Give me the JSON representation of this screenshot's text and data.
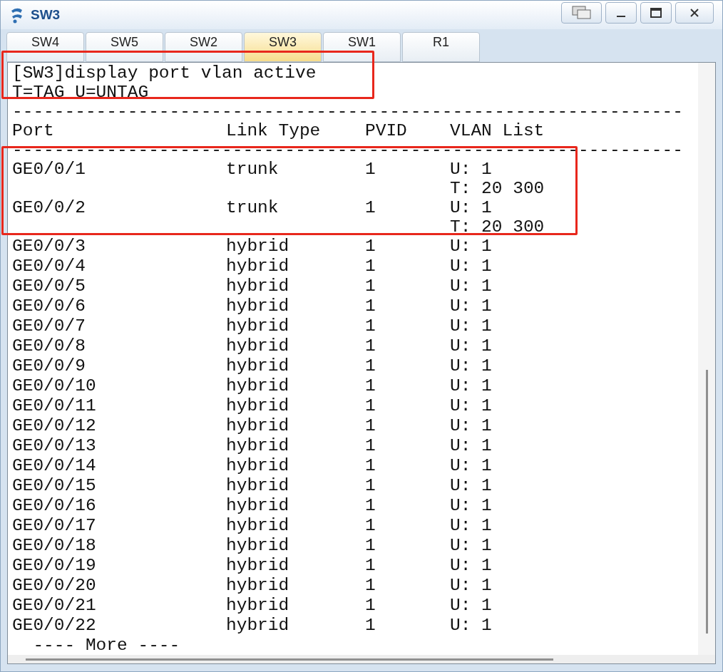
{
  "window": {
    "title": "SW3"
  },
  "tabs": [
    {
      "label": "SW4",
      "selected": false
    },
    {
      "label": "SW5",
      "selected": false
    },
    {
      "label": "SW2",
      "selected": false
    },
    {
      "label": "SW3",
      "selected": true
    },
    {
      "label": "SW1",
      "selected": false
    },
    {
      "label": "R1",
      "selected": false
    }
  ],
  "terminal": {
    "command": "[SW3]display port vlan active",
    "legend": "T=TAG U=UNTAG",
    "separator": "----------------------------------------------------------------",
    "columns": [
      "Port",
      "Link Type",
      "PVID",
      "VLAN List"
    ],
    "rows": [
      {
        "port": "GE0/0/1",
        "link_type": "trunk",
        "pvid": "1",
        "vlan_list": [
          "U: 1",
          "T: 20 300"
        ]
      },
      {
        "port": "GE0/0/2",
        "link_type": "trunk",
        "pvid": "1",
        "vlan_list": [
          "U: 1",
          "T: 20 300"
        ]
      },
      {
        "port": "GE0/0/3",
        "link_type": "hybrid",
        "pvid": "1",
        "vlan_list": [
          "U: 1"
        ]
      },
      {
        "port": "GE0/0/4",
        "link_type": "hybrid",
        "pvid": "1",
        "vlan_list": [
          "U: 1"
        ]
      },
      {
        "port": "GE0/0/5",
        "link_type": "hybrid",
        "pvid": "1",
        "vlan_list": [
          "U: 1"
        ]
      },
      {
        "port": "GE0/0/6",
        "link_type": "hybrid",
        "pvid": "1",
        "vlan_list": [
          "U: 1"
        ]
      },
      {
        "port": "GE0/0/7",
        "link_type": "hybrid",
        "pvid": "1",
        "vlan_list": [
          "U: 1"
        ]
      },
      {
        "port": "GE0/0/8",
        "link_type": "hybrid",
        "pvid": "1",
        "vlan_list": [
          "U: 1"
        ]
      },
      {
        "port": "GE0/0/9",
        "link_type": "hybrid",
        "pvid": "1",
        "vlan_list": [
          "U: 1"
        ]
      },
      {
        "port": "GE0/0/10",
        "link_type": "hybrid",
        "pvid": "1",
        "vlan_list": [
          "U: 1"
        ]
      },
      {
        "port": "GE0/0/11",
        "link_type": "hybrid",
        "pvid": "1",
        "vlan_list": [
          "U: 1"
        ]
      },
      {
        "port": "GE0/0/12",
        "link_type": "hybrid",
        "pvid": "1",
        "vlan_list": [
          "U: 1"
        ]
      },
      {
        "port": "GE0/0/13",
        "link_type": "hybrid",
        "pvid": "1",
        "vlan_list": [
          "U: 1"
        ]
      },
      {
        "port": "GE0/0/14",
        "link_type": "hybrid",
        "pvid": "1",
        "vlan_list": [
          "U: 1"
        ]
      },
      {
        "port": "GE0/0/15",
        "link_type": "hybrid",
        "pvid": "1",
        "vlan_list": [
          "U: 1"
        ]
      },
      {
        "port": "GE0/0/16",
        "link_type": "hybrid",
        "pvid": "1",
        "vlan_list": [
          "U: 1"
        ]
      },
      {
        "port": "GE0/0/17",
        "link_type": "hybrid",
        "pvid": "1",
        "vlan_list": [
          "U: 1"
        ]
      },
      {
        "port": "GE0/0/18",
        "link_type": "hybrid",
        "pvid": "1",
        "vlan_list": [
          "U: 1"
        ]
      },
      {
        "port": "GE0/0/19",
        "link_type": "hybrid",
        "pvid": "1",
        "vlan_list": [
          "U: 1"
        ]
      },
      {
        "port": "GE0/0/20",
        "link_type": "hybrid",
        "pvid": "1",
        "vlan_list": [
          "U: 1"
        ]
      },
      {
        "port": "GE0/0/21",
        "link_type": "hybrid",
        "pvid": "1",
        "vlan_list": [
          "U: 1"
        ]
      },
      {
        "port": "GE0/0/22",
        "link_type": "hybrid",
        "pvid": "1",
        "vlan_list": [
          "U: 1"
        ]
      }
    ],
    "more_prompt": "  ---- More ----"
  }
}
